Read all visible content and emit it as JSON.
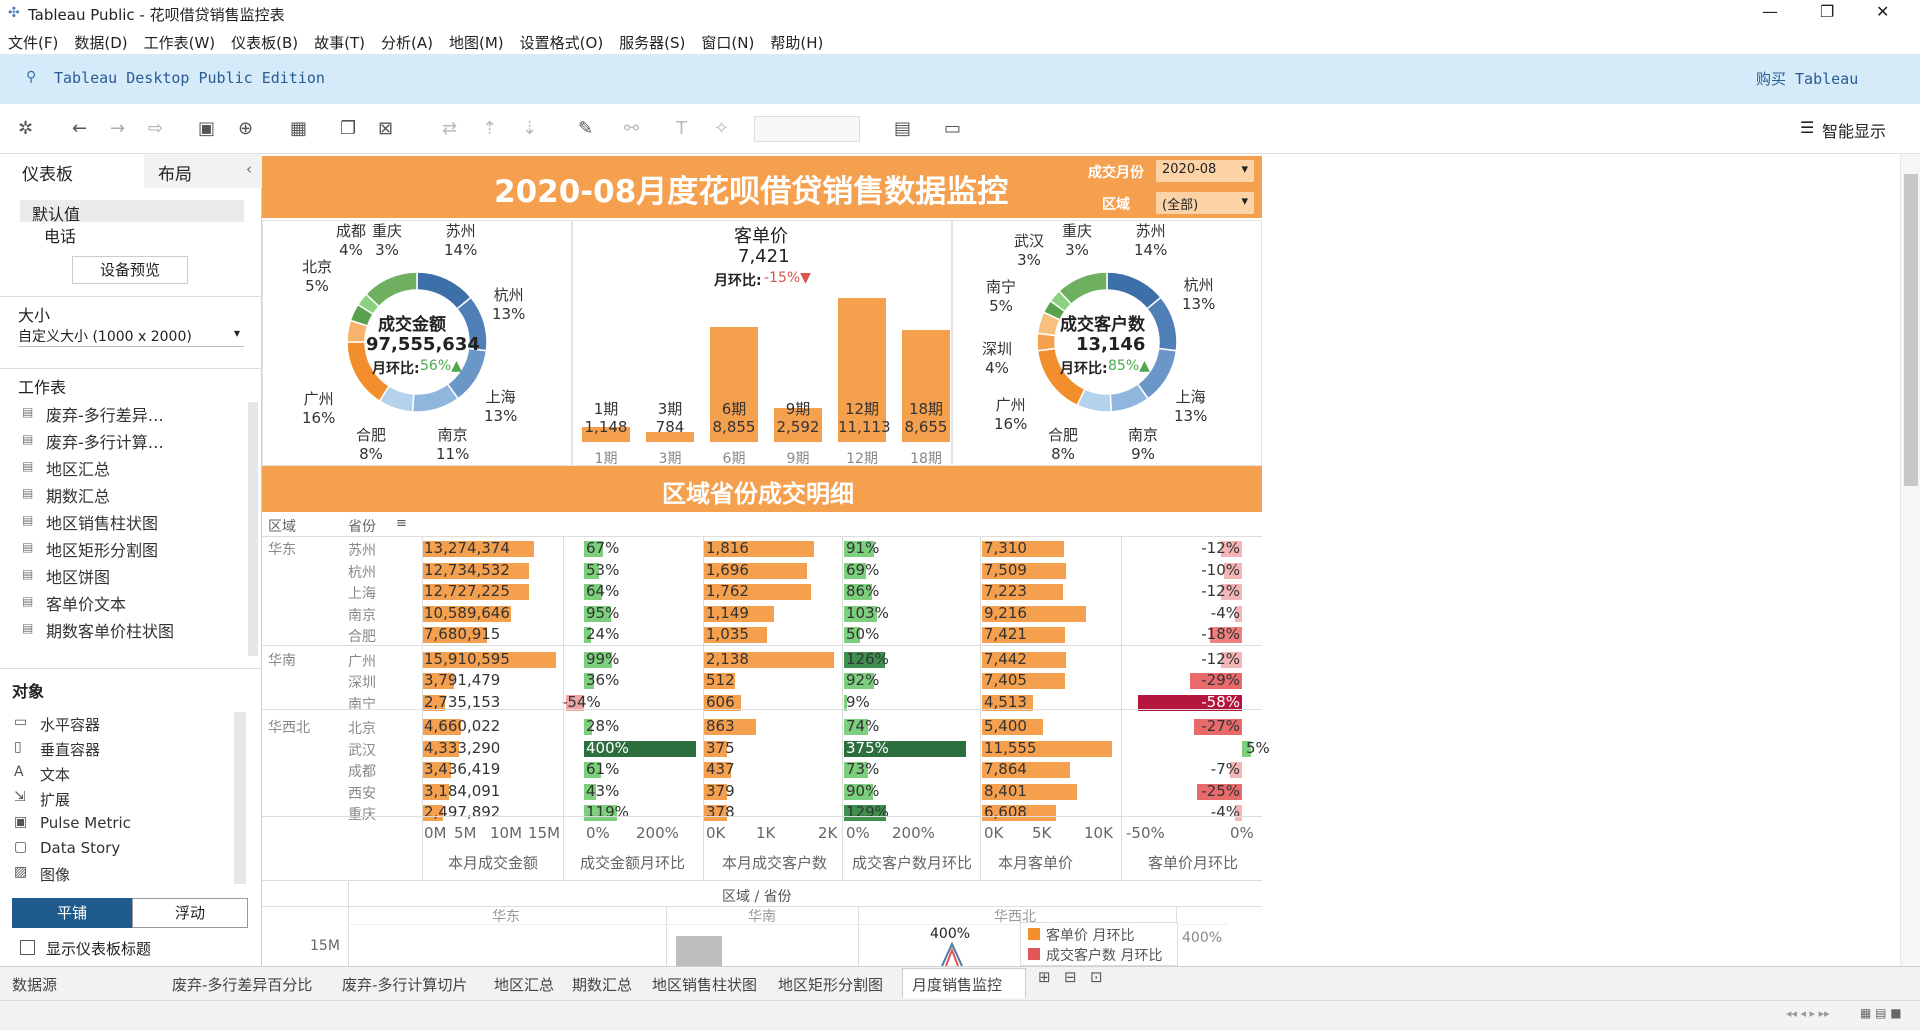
{
  "window": {
    "title": "Tableau Public - 花呗借贷销售监控表",
    "min": "—",
    "max": "❐",
    "close": "✕"
  },
  "menu": [
    "文件(F)",
    "数据(D)",
    "工作表(W)",
    "仪表板(B)",
    "故事(T)",
    "分析(A)",
    "地图(M)",
    "设置格式(O)",
    "服务器(S)",
    "窗口(N)",
    "帮助(H)"
  ],
  "banner": {
    "edition": "Tableau Desktop Public Edition",
    "buy": "购买 Tableau"
  },
  "toolbar": {
    "smart": "智能显示"
  },
  "left": {
    "tab_dashboard": "仪表板",
    "tab_layout": "布局",
    "device_default": "默认值",
    "device_phone": "电话",
    "device_preview": "设备预览",
    "size_label": "大小",
    "size_value": "自定义大小 (1000 x 2000)",
    "sheets_label": "工作表",
    "sheets": [
      "废弃-多行差异…",
      "废弃-多行计算…",
      "地区汇总",
      "期数汇总",
      "地区销售柱状图",
      "地区矩形分割图",
      "地区饼图",
      "客单价文本",
      "期数客单价柱状图"
    ],
    "objects_label": "对象",
    "objects": [
      "水平容器",
      "垂直容器",
      "文本",
      "扩展",
      "Pulse Metric",
      "Data Story",
      "图像"
    ],
    "tile": "平铺",
    "float": "浮动",
    "show_title": "显示仪表板标题"
  },
  "dashboard": {
    "title": "2020-08月度花呗借贷销售数据监控",
    "filter_month_label": "成交月份",
    "filter_month_value": "2020-08",
    "filter_region_label": "区域",
    "filter_region_value": "(全部)",
    "kpi_amount": {
      "label": "成交金额",
      "value": "97,555,634",
      "mom_label": "月环比:",
      "mom": "56%▲"
    },
    "kpi_customers": {
      "label": "成交客户数",
      "value": "13,146",
      "mom_label": "月环比:",
      "mom": "85%▲"
    },
    "kpi_price": {
      "label": "客单价",
      "value": "7,421",
      "mom_label": "月环比:",
      "mom": "-15%▼"
    },
    "donut_left": [
      {
        "name": "苏州",
        "pct": "14%"
      },
      {
        "name": "杭州",
        "pct": "13%"
      },
      {
        "name": "上海",
        "pct": "13%"
      },
      {
        "name": "南京",
        "pct": "11%"
      },
      {
        "name": "合肥",
        "pct": "8%"
      },
      {
        "name": "广州",
        "pct": "16%"
      },
      {
        "name": "北京",
        "pct": "5%"
      },
      {
        "name": "成都",
        "pct": "4%"
      },
      {
        "name": "重庆",
        "pct": "3%"
      }
    ],
    "donut_right": [
      {
        "name": "苏州",
        "pct": "14%"
      },
      {
        "name": "杭州",
        "pct": "13%"
      },
      {
        "name": "上海",
        "pct": "13%"
      },
      {
        "name": "南京",
        "pct": "9%"
      },
      {
        "name": "合肥",
        "pct": "8%"
      },
      {
        "name": "广州",
        "pct": "16%"
      },
      {
        "name": "深圳",
        "pct": "4%"
      },
      {
        "name": "南宁",
        "pct": "5%"
      },
      {
        "name": "武汉",
        "pct": "3%"
      },
      {
        "name": "重庆",
        "pct": "3%"
      }
    ],
    "period_bars": [
      {
        "period": "1期",
        "value": "1,148"
      },
      {
        "period": "3期",
        "value": "784"
      },
      {
        "period": "6期",
        "value": "8,855"
      },
      {
        "period": "9期",
        "value": "2,592"
      },
      {
        "period": "12期",
        "value": "11,113"
      },
      {
        "period": "18期",
        "value": "8,655"
      }
    ],
    "section_title": "区域省份成交明细",
    "table_headers": {
      "region": "区域",
      "province": "省份"
    },
    "table": [
      {
        "region": "华东",
        "province": "苏州",
        "amount": "13,274,374",
        "amt_mom": "67%",
        "cust": "1,816",
        "cust_mom": "91%",
        "price": "7,310",
        "price_mom": "-12%"
      },
      {
        "region": "",
        "province": "杭州",
        "amount": "12,734,532",
        "amt_mom": "53%",
        "cust": "1,696",
        "cust_mom": "69%",
        "price": "7,509",
        "price_mom": "-10%"
      },
      {
        "region": "",
        "province": "上海",
        "amount": "12,727,225",
        "amt_mom": "64%",
        "cust": "1,762",
        "cust_mom": "86%",
        "price": "7,223",
        "price_mom": "-12%"
      },
      {
        "region": "",
        "province": "南京",
        "amount": "10,589,646",
        "amt_mom": "95%",
        "cust": "1,149",
        "cust_mom": "103%",
        "price": "9,216",
        "price_mom": "-4%"
      },
      {
        "region": "",
        "province": "合肥",
        "amount": "7,680,915",
        "amt_mom": "24%",
        "cust": "1,035",
        "cust_mom": "50%",
        "price": "7,421",
        "price_mom": "-18%"
      },
      {
        "region": "华南",
        "province": "广州",
        "amount": "15,910,595",
        "amt_mom": "99%",
        "cust": "2,138",
        "cust_mom": "126%",
        "price": "7,442",
        "price_mom": "-12%"
      },
      {
        "region": "",
        "province": "深圳",
        "amount": "3,791,479",
        "amt_mom": "36%",
        "cust": "512",
        "cust_mom": "92%",
        "price": "7,405",
        "price_mom": "-29%"
      },
      {
        "region": "",
        "province": "南宁",
        "amount": "2,735,153",
        "amt_mom": "-54%",
        "cust": "606",
        "cust_mom": "9%",
        "price": "4,513",
        "price_mom": "-58%"
      },
      {
        "region": "华西北",
        "province": "北京",
        "amount": "4,660,022",
        "amt_mom": "28%",
        "cust": "863",
        "cust_mom": "74%",
        "price": "5,400",
        "price_mom": "-27%"
      },
      {
        "region": "",
        "province": "武汉",
        "amount": "4,333,290",
        "amt_mom": "400%",
        "cust": "375",
        "cust_mom": "375%",
        "price": "11,555",
        "price_mom": "5%"
      },
      {
        "region": "",
        "province": "成都",
        "amount": "3,436,419",
        "amt_mom": "61%",
        "cust": "437",
        "cust_mom": "73%",
        "price": "7,864",
        "price_mom": "-7%"
      },
      {
        "region": "",
        "province": "西安",
        "amount": "3,184,091",
        "amt_mom": "43%",
        "cust": "379",
        "cust_mom": "90%",
        "price": "8,401",
        "price_mom": "-25%"
      },
      {
        "region": "",
        "province": "重庆",
        "amount": "2,497,892",
        "amt_mom": "119%",
        "cust": "378",
        "cust_mom": "129%",
        "price": "6,608",
        "price_mom": "-4%"
      }
    ],
    "axis_labels": {
      "amount": [
        "0M",
        "5M",
        "10M",
        "15M"
      ],
      "amt_mom": [
        "0%",
        "200%"
      ],
      "cust": [
        "0K",
        "1K",
        "2K"
      ],
      "cust_mom": [
        "0%",
        "200%"
      ],
      "price": [
        "0K",
        "5K",
        "10K"
      ],
      "price_mom": [
        "-50%",
        "0%"
      ]
    },
    "col_titles": [
      "本月成交金额",
      "成交金额月环比",
      "本月成交客户数",
      "成交客户数月环比",
      "本月客单价",
      "客单价月环比"
    ],
    "lower_chart": {
      "header": "区域 / 省份",
      "regions": [
        "华东",
        "华南",
        "华西北"
      ],
      "y_tick": "15M",
      "annot": "400%",
      "right_tick": "400%",
      "legend": [
        {
          "name": "客单价 月环比",
          "color": "#f28e2b"
        },
        {
          "name": "成交客户数 月环比",
          "color": "#e15759"
        }
      ]
    }
  },
  "bottom_tabs": [
    "数据源",
    "废弃-多行差异百分比",
    "废弃-多行计算切片",
    "地区汇总",
    "期数汇总",
    "地区销售柱状图",
    "地区矩形分割图",
    "月度销售监控"
  ],
  "colors": {
    "orange": "#f5a04e",
    "green": "#7ccf7c",
    "dark_green": "#2c6e3e",
    "red_light": "#f0a3a3",
    "red_dark": "#b5163d"
  }
}
